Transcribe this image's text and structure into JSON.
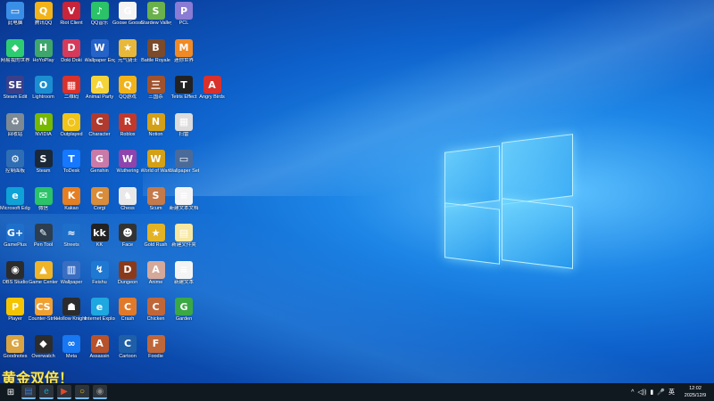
{
  "desktop": {
    "icons": [
      {
        "label": "此电脑",
        "symbol": "▭",
        "color": "#3a8ee6"
      },
      {
        "label": "腾讯QQ",
        "symbol": "Q",
        "color": "#f2b31a"
      },
      {
        "label": "Riot Client",
        "symbol": "V",
        "color": "#c8243a"
      },
      {
        "label": "QQ音乐",
        "symbol": "♪",
        "color": "#2bc268"
      },
      {
        "label": "Goose Goose Duck",
        "symbol": "G",
        "color": "#f4f4f4"
      },
      {
        "label": "Stardew Valley",
        "symbol": "S",
        "color": "#6ab04c"
      },
      {
        "label": "PCL",
        "symbol": "P",
        "color": "#8a7bd4"
      },
      {
        "label": "网易我的世界",
        "symbol": "◆",
        "color": "#2ecc71"
      },
      {
        "label": "HoYoPlay",
        "symbol": "H",
        "color": "#3fa66b"
      },
      {
        "label": "Doki Doki",
        "symbol": "D",
        "color": "#d63a5a"
      },
      {
        "label": "Wallpaper Engine",
        "symbol": "W",
        "color": "#2563c9"
      },
      {
        "label": "元气骑士",
        "symbol": "★",
        "color": "#e8b83a"
      },
      {
        "label": "Battle Royale",
        "symbol": "B",
        "color": "#7a4a2a"
      },
      {
        "label": "迷你世界",
        "symbol": "M",
        "color": "#f08a24"
      },
      {
        "label": "Steam Edit",
        "symbol": "SE",
        "color": "#3a3f8a"
      },
      {
        "label": "Lightroom",
        "symbol": "O",
        "color": "#1b8ed1"
      },
      {
        "label": "二维码",
        "symbol": "▦",
        "color": "#d9312b"
      },
      {
        "label": "Animal Party",
        "symbol": "A",
        "color": "#f5d43a"
      },
      {
        "label": "QQ游戏",
        "symbol": "Q",
        "color": "#f2b31a"
      },
      {
        "label": "三国杀",
        "symbol": "三",
        "color": "#a0522d"
      },
      {
        "label": "Tetris Effect",
        "symbol": "T",
        "color": "#222"
      },
      {
        "label": "Angry Birds",
        "symbol": "A",
        "color": "#d9312b"
      },
      {
        "label": "回收站",
        "symbol": "♻",
        "color": "#7d8a94"
      },
      {
        "label": "NVIDIA",
        "symbol": "N",
        "color": "#76b900"
      },
      {
        "label": "Outplayed",
        "symbol": "○",
        "color": "#f0c419"
      },
      {
        "label": "Character",
        "symbol": "C",
        "color": "#b03a2e"
      },
      {
        "label": "Roblox",
        "symbol": "R",
        "color": "#c0392b"
      },
      {
        "label": "Notion",
        "symbol": "N",
        "color": "#d4a017"
      },
      {
        "label": "扫雷",
        "symbol": "▦",
        "color": "#dcdcdc"
      },
      {
        "label": "控制面板",
        "symbol": "⚙",
        "color": "#2f6db5"
      },
      {
        "label": "Steam",
        "symbol": "S",
        "color": "#1b2838"
      },
      {
        "label": "ToDesk",
        "symbol": "T",
        "color": "#1677ff"
      },
      {
        "label": "Genshin",
        "symbol": "G",
        "color": "#c97aa8"
      },
      {
        "label": "Wuthering",
        "symbol": "W",
        "color": "#8e44ad"
      },
      {
        "label": "World of Warcraft",
        "symbol": "W",
        "color": "#d4a017"
      },
      {
        "label": "Wallpaper Set",
        "symbol": "▭",
        "color": "#4a6a9a"
      },
      {
        "label": "Microsoft Edge",
        "symbol": "e",
        "color": "#0fa2d6"
      },
      {
        "label": "微信",
        "symbol": "✉",
        "color": "#2bc268"
      },
      {
        "label": "Kakao",
        "symbol": "K",
        "color": "#e67e22"
      },
      {
        "label": "Corgi",
        "symbol": "C",
        "color": "#d98c3a"
      },
      {
        "label": "Chess",
        "symbol": "♞",
        "color": "#e8e8e8"
      },
      {
        "label": "Scum",
        "symbol": "S",
        "color": "#c47a4a"
      },
      {
        "label": "新建文本文档",
        "symbol": "≡",
        "color": "#f4f4f4"
      },
      {
        "label": "GamePlus",
        "symbol": "G+",
        "color": "#1e6fc9"
      },
      {
        "label": "Pen Tool",
        "symbol": "✎",
        "color": "#2c3e50"
      },
      {
        "label": "Streets",
        "symbol": "≈",
        "color": "#1e6fc9"
      },
      {
        "label": "KK",
        "symbol": "kk",
        "color": "#222"
      },
      {
        "label": "Face",
        "symbol": "☻",
        "color": "#333"
      },
      {
        "label": "Gold Rush",
        "symbol": "★",
        "color": "#e2b326"
      },
      {
        "label": "新建文件夹",
        "symbol": "▤",
        "color": "#f6e7a1"
      },
      {
        "label": "OBS Studio",
        "symbol": "◉",
        "color": "#2c2c2c"
      },
      {
        "label": "Game Center",
        "symbol": "▲",
        "color": "#f0b429"
      },
      {
        "label": "Wallpaper",
        "symbol": "▥",
        "color": "#3a6ec2"
      },
      {
        "label": "Feishu",
        "symbol": "↯",
        "color": "#1f78d1"
      },
      {
        "label": "Dungeon",
        "symbol": "D",
        "color": "#8a3a1a"
      },
      {
        "label": "Anime",
        "symbol": "A",
        "color": "#d4a99a"
      },
      {
        "label": "新建文本",
        "symbol": "≡",
        "color": "#f4f4f4"
      },
      {
        "label": "Player",
        "symbol": "P",
        "color": "#f5c400"
      },
      {
        "label": "Counter-Strike",
        "symbol": "CS",
        "color": "#f0a030"
      },
      {
        "label": "Hollow Knight",
        "symbol": "☗",
        "color": "#2c2c2c"
      },
      {
        "label": "Internet Explorer",
        "symbol": "e",
        "color": "#1ea7e0"
      },
      {
        "label": "Crash",
        "symbol": "C",
        "color": "#e07a2a"
      },
      {
        "label": "Chicken",
        "symbol": "C",
        "color": "#c0673a"
      },
      {
        "label": "Garden",
        "symbol": "G",
        "color": "#3aa845"
      },
      {
        "label": "Goodnotes",
        "symbol": "G",
        "color": "#d9a441"
      },
      {
        "label": "Overwatch",
        "symbol": "◆",
        "color": "#2c2c2c"
      },
      {
        "label": "Meta",
        "symbol": "∞",
        "color": "#1877f2"
      },
      {
        "label": "Assassin",
        "symbol": "A",
        "color": "#b8522a"
      },
      {
        "label": "Cartoon",
        "symbol": "C",
        "color": "#1e5fa8"
      },
      {
        "label": "Foodie",
        "symbol": "F",
        "color": "#c0673a"
      }
    ],
    "promo_text": "黄金双倍！"
  },
  "taskbar": {
    "start_symbol": "⊞",
    "apps": [
      {
        "name": "task-view",
        "symbol": "▤",
        "color": "#3a7bd5"
      },
      {
        "name": "edge",
        "symbol": "e",
        "color": "#0fa2d6"
      },
      {
        "name": "media",
        "symbol": "▶",
        "color": "#e04a2a"
      },
      {
        "name": "outplayed",
        "symbol": "○",
        "color": "#f0c419"
      },
      {
        "name": "obs",
        "symbol": "◉",
        "color": "#888"
      }
    ],
    "tray": {
      "chevron": "^",
      "volume": "◁))",
      "network": "▮",
      "mic": "🎤",
      "ime": "英"
    },
    "clock": {
      "time": "12:02",
      "date": "2025/12/9"
    }
  }
}
